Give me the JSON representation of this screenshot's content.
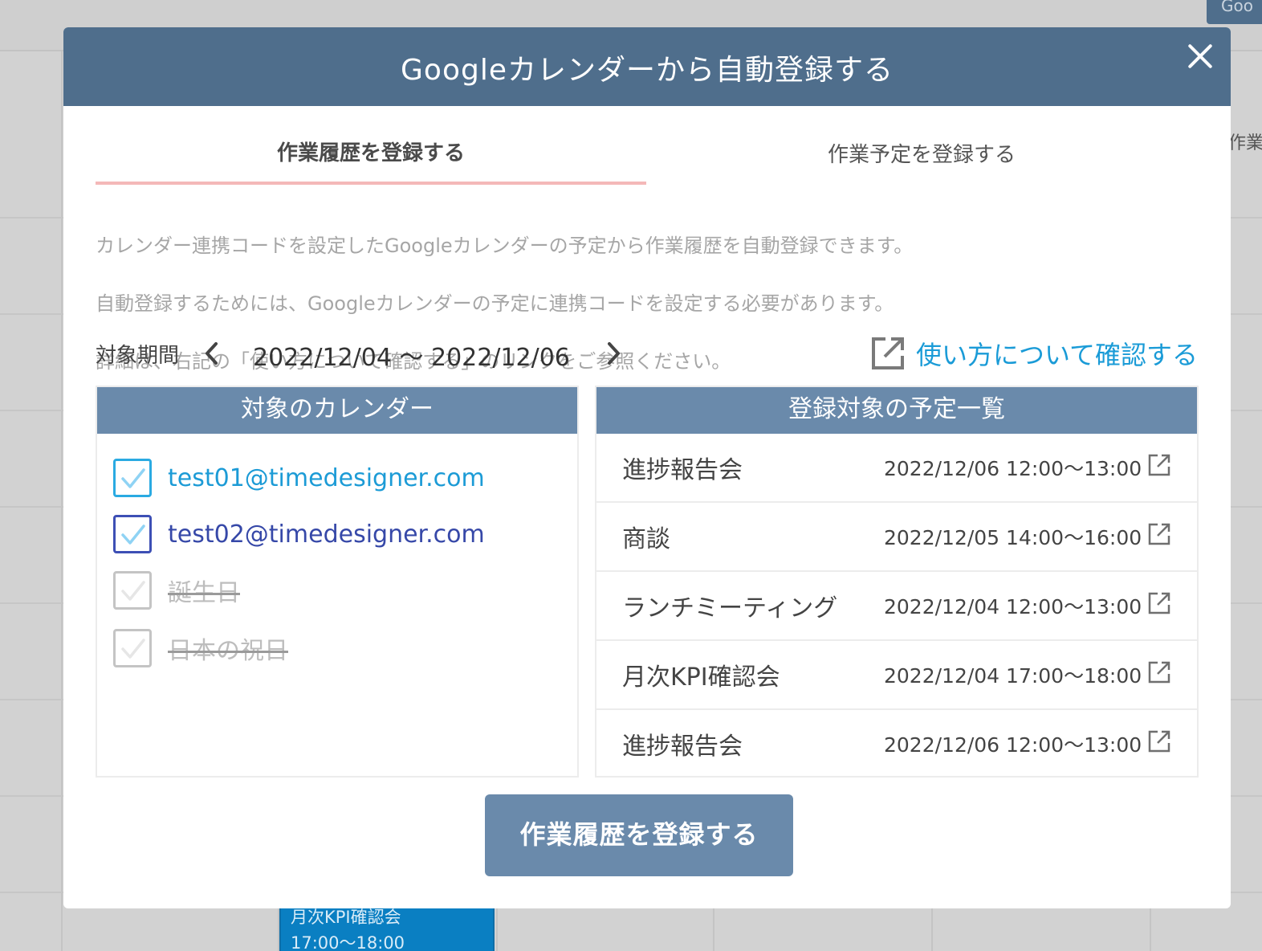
{
  "background": {
    "corner_button": "Goo",
    "side_text": "作業",
    "event": {
      "title": "月次KPI確認会",
      "time": "17:00〜18:00"
    }
  },
  "modal": {
    "title": "Googleカレンダーから自動登録する",
    "tabs": [
      {
        "label": "作業履歴を登録する",
        "active": true
      },
      {
        "label": "作業予定を登録する",
        "active": false
      }
    ],
    "description": [
      "カレンダー連携コードを設定したGoogleカレンダーの予定から作業履歴を自動登録できます。",
      "自動登録するためには、Googleカレンダーの予定に連携コードを設定する必要があります。",
      "詳細は、右記の「使い方について確認する」のリンクをご参照ください。"
    ],
    "period": {
      "label": "対象期間",
      "range": "2022/12/04 〜 2022/12/06"
    },
    "help_link": "使い方について確認する",
    "calendars": {
      "header": "対象のカレンダー",
      "items": [
        {
          "label": "test01@timedesigner.com",
          "checked": true,
          "color": "#2aaae2"
        },
        {
          "label": "test02@timedesigner.com",
          "checked": true,
          "color": "#3d4fb5"
        },
        {
          "label": "誕生日",
          "checked": false,
          "disabled": true
        },
        {
          "label": "日本の祝日",
          "checked": false,
          "disabled": true
        }
      ]
    },
    "events": {
      "header": "登録対象の予定一覧",
      "items": [
        {
          "name": "進捗報告会",
          "time": "2022/12/06 12:00〜13:00"
        },
        {
          "name": "商談",
          "time": "2022/12/05 14:00〜16:00"
        },
        {
          "name": "ランチミーティング",
          "time": "2022/12/04 12:00〜13:00"
        },
        {
          "name": "月次KPI確認会",
          "time": "2022/12/04 17:00〜18:00"
        },
        {
          "name": "進捗報告会",
          "time": "2022/12/06 12:00〜13:00"
        }
      ]
    },
    "submit_label": "作業履歴を登録する"
  }
}
